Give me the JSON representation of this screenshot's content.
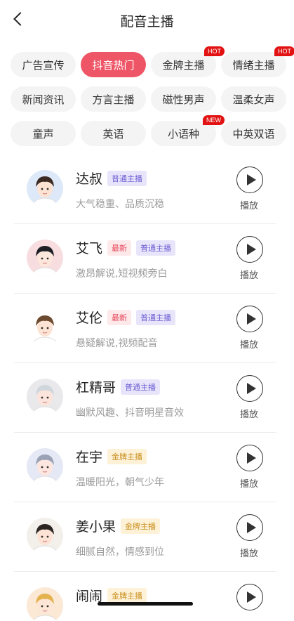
{
  "header": {
    "title": "配音主播"
  },
  "chips": [
    [
      {
        "label": "广告宣传",
        "active": false,
        "badge": ""
      },
      {
        "label": "抖音热门",
        "active": true,
        "badge": ""
      },
      {
        "label": "金牌主播",
        "active": false,
        "badge": "HOT"
      },
      {
        "label": "情绪主播",
        "active": false,
        "badge": "HOT"
      }
    ],
    [
      {
        "label": "新闻资讯",
        "active": false,
        "badge": ""
      },
      {
        "label": "方言主播",
        "active": false,
        "badge": ""
      },
      {
        "label": "磁性男声",
        "active": false,
        "badge": ""
      },
      {
        "label": "温柔女声",
        "active": false,
        "badge": ""
      }
    ],
    [
      {
        "label": "童声",
        "active": false,
        "badge": ""
      },
      {
        "label": "英语",
        "active": false,
        "badge": ""
      },
      {
        "label": "小语种",
        "active": false,
        "badge": "NEW"
      },
      {
        "label": "中英双语",
        "active": false,
        "badge": ""
      }
    ]
  ],
  "anchors": [
    {
      "name": "达叔",
      "tags": [
        {
          "text": "普通主播",
          "kind": "normal"
        }
      ],
      "desc": "大气稳重、品质沉稳",
      "play_label": "播放"
    },
    {
      "name": "艾飞",
      "tags": [
        {
          "text": "最新",
          "kind": "new"
        },
        {
          "text": "普通主播",
          "kind": "normal"
        }
      ],
      "desc": "激昂解说,短视频旁白",
      "play_label": "播放"
    },
    {
      "name": "艾伦",
      "tags": [
        {
          "text": "最新",
          "kind": "new"
        },
        {
          "text": "普通主播",
          "kind": "normal"
        }
      ],
      "desc": "悬疑解说,视频配音",
      "play_label": "播放"
    },
    {
      "name": "杠精哥",
      "tags": [
        {
          "text": "普通主播",
          "kind": "normal"
        }
      ],
      "desc": "幽默风趣、抖音明星音效",
      "play_label": "播放"
    },
    {
      "name": "在宇",
      "tags": [
        {
          "text": "金牌主播",
          "kind": "gold"
        }
      ],
      "desc": "温暖阳光，朝气少年",
      "play_label": "播放"
    },
    {
      "name": "姜小果",
      "tags": [
        {
          "text": "金牌主播",
          "kind": "gold"
        }
      ],
      "desc": "细腻自然，情感到位",
      "play_label": "播放"
    },
    {
      "name": "闹闹",
      "tags": [
        {
          "text": "金牌主播",
          "kind": "gold"
        }
      ],
      "desc": "",
      "play_label": ""
    }
  ],
  "colors": {
    "accent": "#ee5566",
    "badge": "#e21212"
  }
}
